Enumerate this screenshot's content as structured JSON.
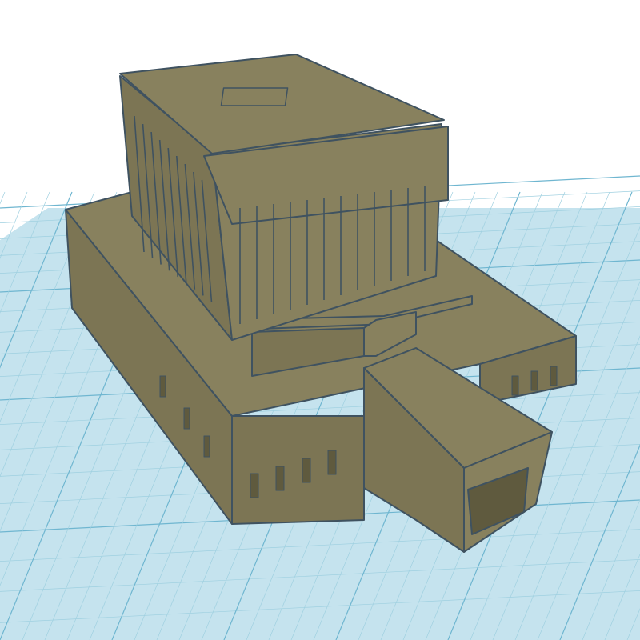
{
  "app": {
    "view": "3d-workplane",
    "icon": "workplane-grid"
  },
  "model": {
    "name": "",
    "object": "classical-temple-building",
    "parts": [
      "upper-temple-block",
      "lower-podium-base",
      "front-entrance-annex"
    ]
  },
  "colors": {
    "background": "#ffffff",
    "workplane": "#c5e3ee",
    "grid_minor": "#9fd0e0",
    "grid_major": "#6fb6d0",
    "model_top": "#88815e",
    "model_side": "#7c7554",
    "model_dark": "#5f5a3e",
    "model_edge": "#3f5260"
  }
}
